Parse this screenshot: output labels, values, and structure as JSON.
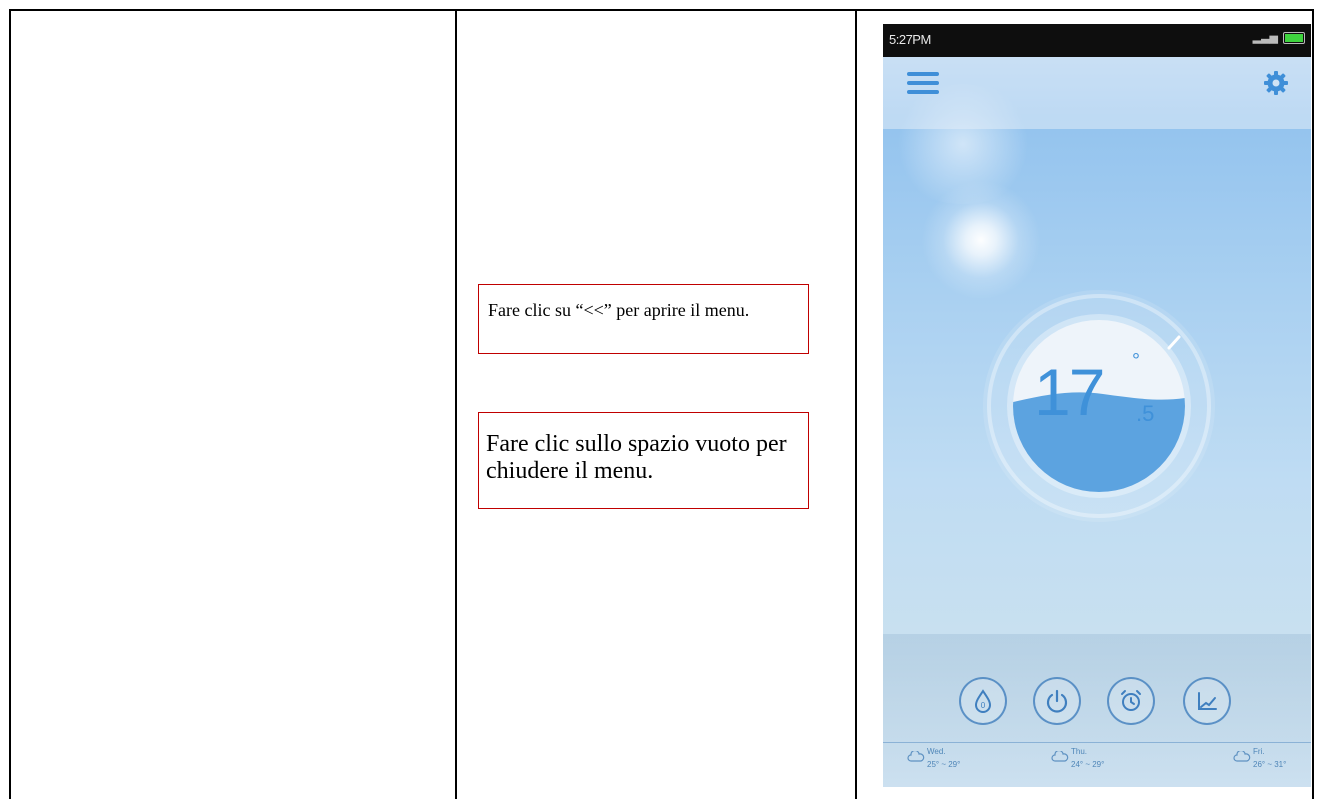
{
  "notes": {
    "open_menu": "Fare clic su “<<” per aprire il menu.",
    "close_menu": "Fare clic sullo spazio vuoto per chiudere il menu."
  },
  "phone": {
    "status_time": "5:27PM",
    "temperature": {
      "integer": "17",
      "decimal": ".5",
      "degree": "°"
    },
    "controls": [
      {
        "icon": "humidity-drop-icon"
      },
      {
        "icon": "power-icon"
      },
      {
        "icon": "alarm-clock-icon"
      },
      {
        "icon": "chart-icon"
      }
    ],
    "forecast": [
      {
        "day": "Wed.",
        "range": "25° ~ 29°",
        "icon": "cloud-icon"
      },
      {
        "day": "Thu.",
        "range": "24° ~ 29°",
        "icon": "cloud-icon"
      },
      {
        "day": "Fri.",
        "range": "26° ~ 31°",
        "icon": "cloud-icon"
      }
    ],
    "colors": {
      "accent": "#3f91d9",
      "status_bar": "#0e0e0e",
      "battery": "#3fd33f"
    }
  }
}
